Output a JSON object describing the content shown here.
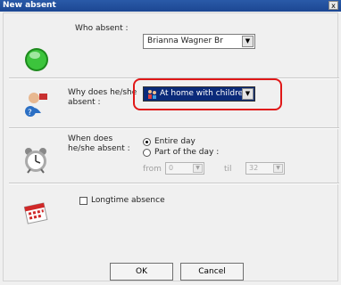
{
  "window": {
    "title": "New absent",
    "close_label": "x"
  },
  "who": {
    "label": "Who absent :",
    "value": "Brianna Wagner    Br"
  },
  "why": {
    "label": "Why does he/she absent :",
    "value": "At home with children"
  },
  "when": {
    "label": "When does he/she absent :",
    "entire_day": "Entire day",
    "part_of_day": "Part of the day :",
    "from_label": "from",
    "from_value": "0",
    "til_label": "til",
    "til_value": "32"
  },
  "longtime": {
    "label": "Longtime absence"
  },
  "buttons": {
    "ok": "OK",
    "cancel": "Cancel"
  },
  "colors": {
    "titlebar": "#1c4793",
    "highlight": "#e01818",
    "selection": "#0a2a7a"
  }
}
